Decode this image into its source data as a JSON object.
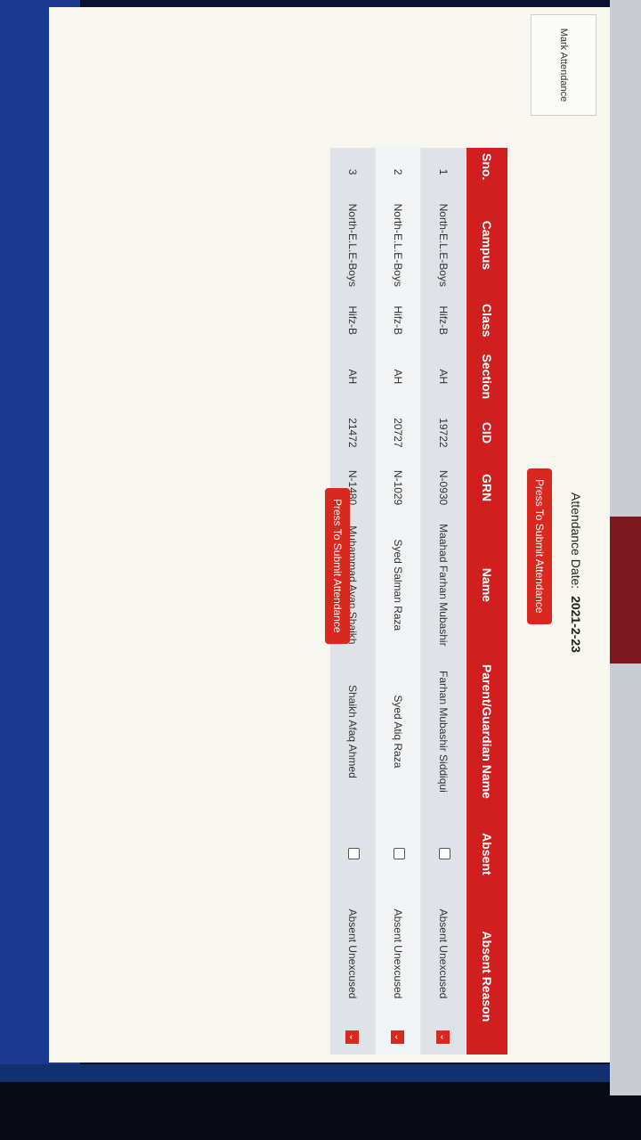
{
  "sidebar": {
    "mark_attendance_label": "Mark Attendance"
  },
  "header": {
    "date_label": "Attendance Date:",
    "date_value": "2021-2-23"
  },
  "actions": {
    "submit_top_label": "Press To Submit Attendance",
    "submit_bottom_label": "Press To Submit Attendance"
  },
  "table": {
    "headers": {
      "sno": "Sno.",
      "campus": "Campus",
      "class": "Class",
      "section": "Section",
      "cid": "CID",
      "grn": "GRN",
      "name": "Name",
      "parent": "Parent/Guardian Name",
      "absent": "Absent",
      "reason": "Absent Reason"
    },
    "rows": [
      {
        "sno": "1",
        "campus": "North-E.L.E-Boys",
        "class": "Hifz-B",
        "section": "AH",
        "cid": "19722",
        "grn": "N-0930",
        "name": "Maahad Farhan Mubashir",
        "parent": "Farhan Mubashir Siddiqui",
        "reason": "Absent Unexcused"
      },
      {
        "sno": "2",
        "campus": "North-E.L.E-Boys",
        "class": "Hifz-B",
        "section": "AH",
        "cid": "20727",
        "grn": "N-1029",
        "name": "Syed Salman Raza",
        "parent": "Syed Atiq Raza",
        "reason": "Absent Unexcused"
      },
      {
        "sno": "3",
        "campus": "North-E.L.E-Boys",
        "class": "Hifz-B",
        "section": "AH",
        "cid": "21472",
        "grn": "N-1480",
        "name": "Muhammad Ayan Shaikh",
        "parent": "Shaikh Afaq Ahmed",
        "reason": "Absent Unexcused"
      }
    ]
  },
  "colors": {
    "accent": "#d11e1e",
    "page_bg": "#f7f6ef"
  }
}
